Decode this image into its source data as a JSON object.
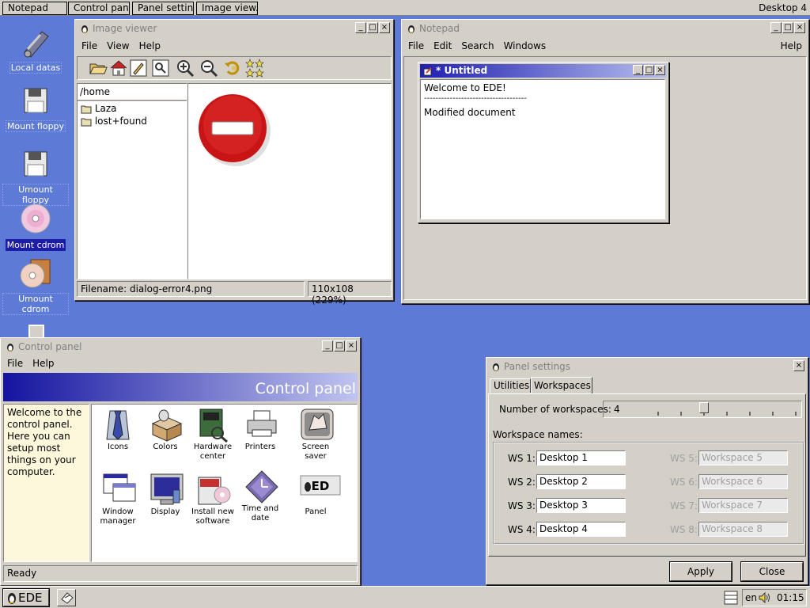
{
  "topbar": {
    "tasks": [
      "Notepad",
      "Control pan..",
      "Panel settin..",
      "Image view.."
    ],
    "desktop": "Desktop 4"
  },
  "desktop_icons": [
    {
      "label": "Local datas",
      "icon": "network-drive-icon"
    },
    {
      "label": "Mount floppy",
      "icon": "floppy-icon"
    },
    {
      "label": "Umount floppy",
      "icon": "floppy-icon"
    },
    {
      "label": "Mount cdrom",
      "icon": "cdrom-icon",
      "selected": true
    },
    {
      "label": "Umount cdrom",
      "icon": "cdrom-icon"
    }
  ],
  "image_viewer": {
    "title": "Image viewer",
    "menu": [
      "File",
      "View",
      "Help"
    ],
    "path": "/home",
    "folders": [
      "Laza",
      "lost+found"
    ],
    "status_filename": "Filename: dialog-error4.png",
    "status_size": "110x108 (229%)"
  },
  "notepad": {
    "title": "Notepad",
    "menu": [
      "File",
      "Edit",
      "Search",
      "Windows",
      "Help"
    ],
    "doc_title": "* Untitled",
    "lines": [
      "Welcome to EDE!",
      "------------------------------------",
      "Modified document"
    ]
  },
  "control_panel": {
    "title": "Control panel",
    "menu": [
      "File",
      "Help"
    ],
    "banner": "Control panel",
    "welcome": "Welcome to the control panel. Here you can setup most things on your computer.",
    "items": [
      {
        "label": "Icons"
      },
      {
        "label": "Colors"
      },
      {
        "label": "Hardware center"
      },
      {
        "label": "Printers"
      },
      {
        "label": "Screen saver"
      },
      {
        "label": "Window manager"
      },
      {
        "label": "Display"
      },
      {
        "label": "Install new software"
      },
      {
        "label": "Time and date"
      },
      {
        "label": "Panel"
      }
    ],
    "status": "Ready"
  },
  "panel_settings": {
    "title": "Panel settings",
    "tabs": [
      "Utilities",
      "Workspaces"
    ],
    "active_tab": "Workspaces",
    "num_label": "Number of workspaces:",
    "num_value": "4",
    "names_label": "Workspace names:",
    "workspaces": [
      {
        "label": "WS 1:",
        "value": "Desktop 1",
        "enabled": true
      },
      {
        "label": "WS 2:",
        "value": "Desktop 2",
        "enabled": true
      },
      {
        "label": "WS 3:",
        "value": "Desktop 3",
        "enabled": true
      },
      {
        "label": "WS 4:",
        "value": "Desktop 4",
        "enabled": true
      },
      {
        "label": "WS 5:",
        "value": "Workspace 5",
        "enabled": false
      },
      {
        "label": "WS 6:",
        "value": "Workspace 6",
        "enabled": false
      },
      {
        "label": "WS 7:",
        "value": "Workspace 7",
        "enabled": false
      },
      {
        "label": "WS 8:",
        "value": "Workspace 8",
        "enabled": false
      }
    ],
    "apply": "Apply",
    "close": "Close"
  },
  "taskbar": {
    "start": "EDE",
    "lang": "en",
    "clock": "01:15"
  }
}
